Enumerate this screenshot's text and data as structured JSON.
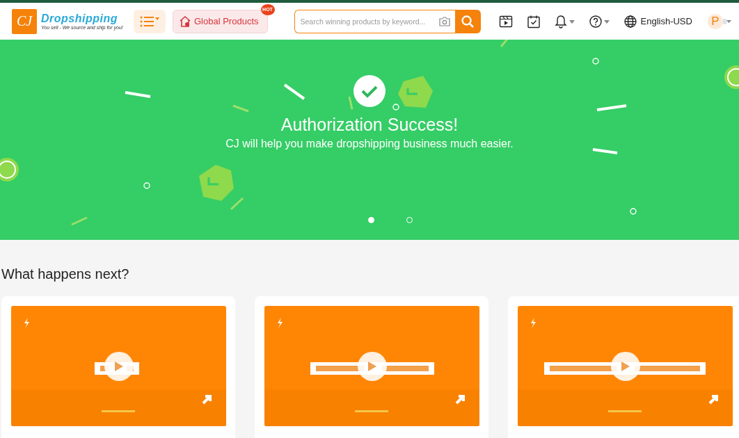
{
  "header": {
    "logo": {
      "mark": "CJ",
      "name": "Dropshipping",
      "tagline": "You sell - We source and ship for you!"
    },
    "global_products": {
      "label": "Global Products",
      "badge": "HOT"
    },
    "search": {
      "placeholder": "Search winning products by keyword..."
    },
    "language": "English-USD",
    "avatar": "P"
  },
  "banner": {
    "title": "Authorization Success!",
    "subtitle": "CJ will help you make dropshipping business much easier.",
    "dots": [
      {
        "selected": true
      },
      {
        "selected": false
      }
    ]
  },
  "section": {
    "title": "What happens next?"
  }
}
